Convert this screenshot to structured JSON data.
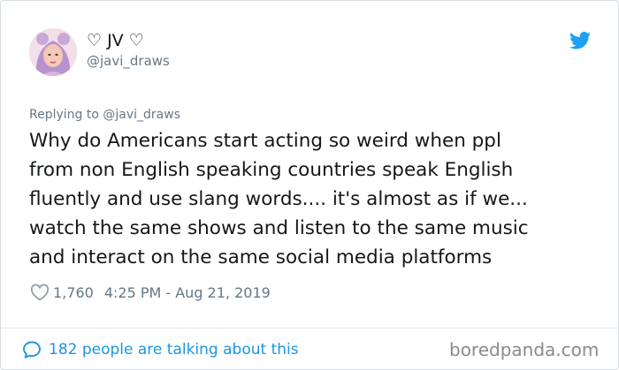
{
  "user": {
    "display_name": "♡ JV ♡",
    "handle": "@javi_draws"
  },
  "reply": {
    "prefix": "Replying to ",
    "mention": "@javi_draws"
  },
  "tweet": {
    "lines": [
      "Why do Americans start acting so weird when ppl",
      "from non English speaking countries speak English",
      "fluently and use slang words.... it's almost as if we...",
      "watch the same shows and listen to the same music",
      "and interact on the same social media platforms"
    ]
  },
  "meta": {
    "likes": "1,760",
    "timestamp": "4:25 PM - Aug 21, 2019"
  },
  "conversation": {
    "label": "182 people are talking about this"
  },
  "watermark": "boredpanda.com",
  "icons": {
    "brand": "twitter-bird-icon",
    "like": "heart-icon",
    "conversation": "speech-bubble-icon"
  },
  "colors": {
    "brand_blue": "#1da1f2",
    "link_blue": "#1b95e0",
    "secondary_text": "#657786",
    "primary_text": "#14171a"
  }
}
